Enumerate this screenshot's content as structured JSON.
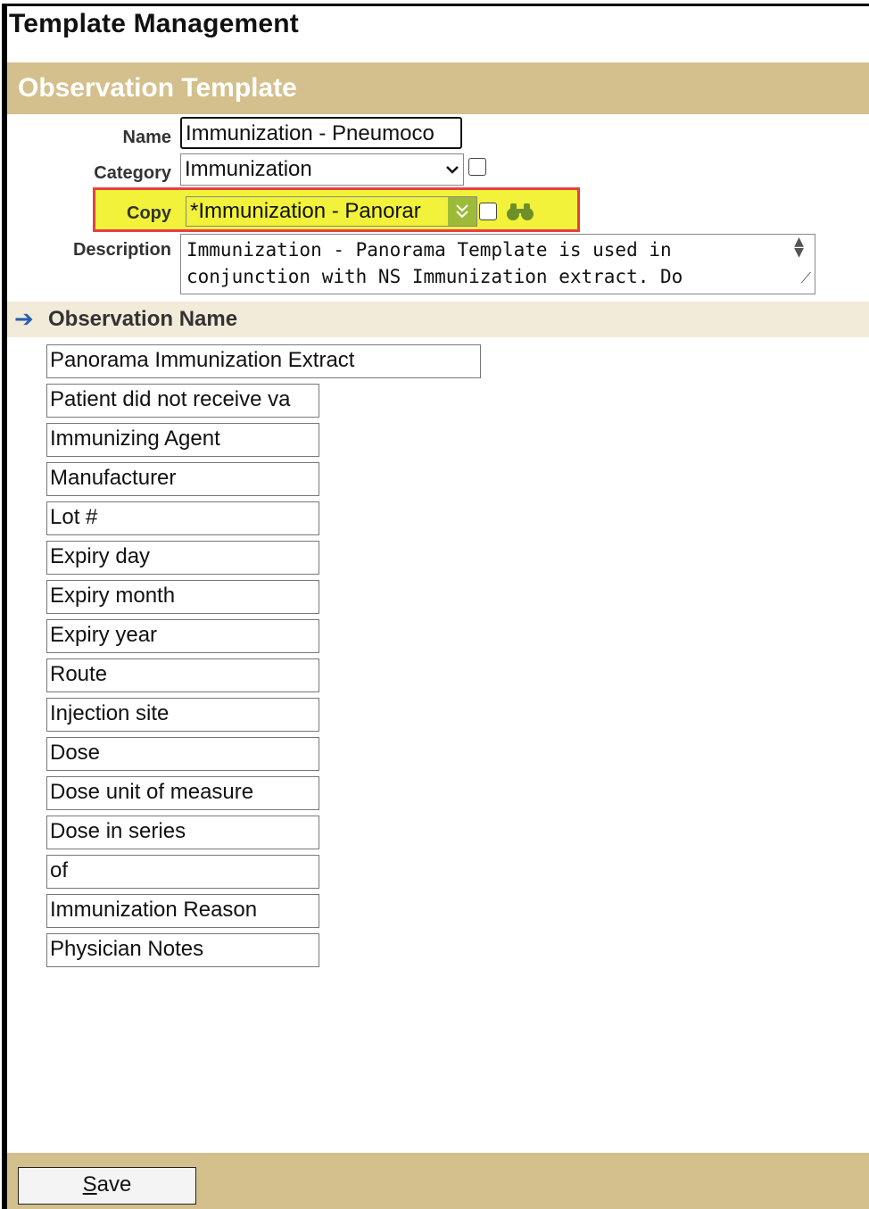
{
  "page": {
    "title": "Template Management"
  },
  "section": {
    "title": "Observation Template"
  },
  "form": {
    "name_label": "Name",
    "name_value": "Immunization - Pneumoco",
    "category_label": "Category",
    "category_value": "Immunization",
    "copy_label": "Copy",
    "copy_value": "*Immunization - Panorar",
    "description_label": "Description",
    "description_value": "Immunization - Panorama Template is used in conjunction with NS Immunization extract. Do"
  },
  "observations": {
    "header": "Observation Name",
    "items": [
      "Panorama Immunization Extract",
      "Patient did not receive va",
      "Immunizing Agent",
      "Manufacturer",
      "Lot #",
      "Expiry day",
      "Expiry month",
      "Expiry year",
      "Route",
      "Injection site",
      "Dose",
      "Dose unit of measure",
      "Dose in series",
      "of",
      "Immunization Reason",
      "Physician Notes"
    ]
  },
  "footer": {
    "save_label_first": "S",
    "save_label_rest": "ave"
  },
  "icons": {
    "search": "binoculars-icon",
    "expand": "double-chevron-down-icon",
    "arrow": "arrow-right-icon"
  },
  "colors": {
    "bar": "#d4c08c",
    "highlight": "#f2f23a",
    "highlight_border": "#e64040",
    "dropdown_button": "#9dbb38"
  }
}
